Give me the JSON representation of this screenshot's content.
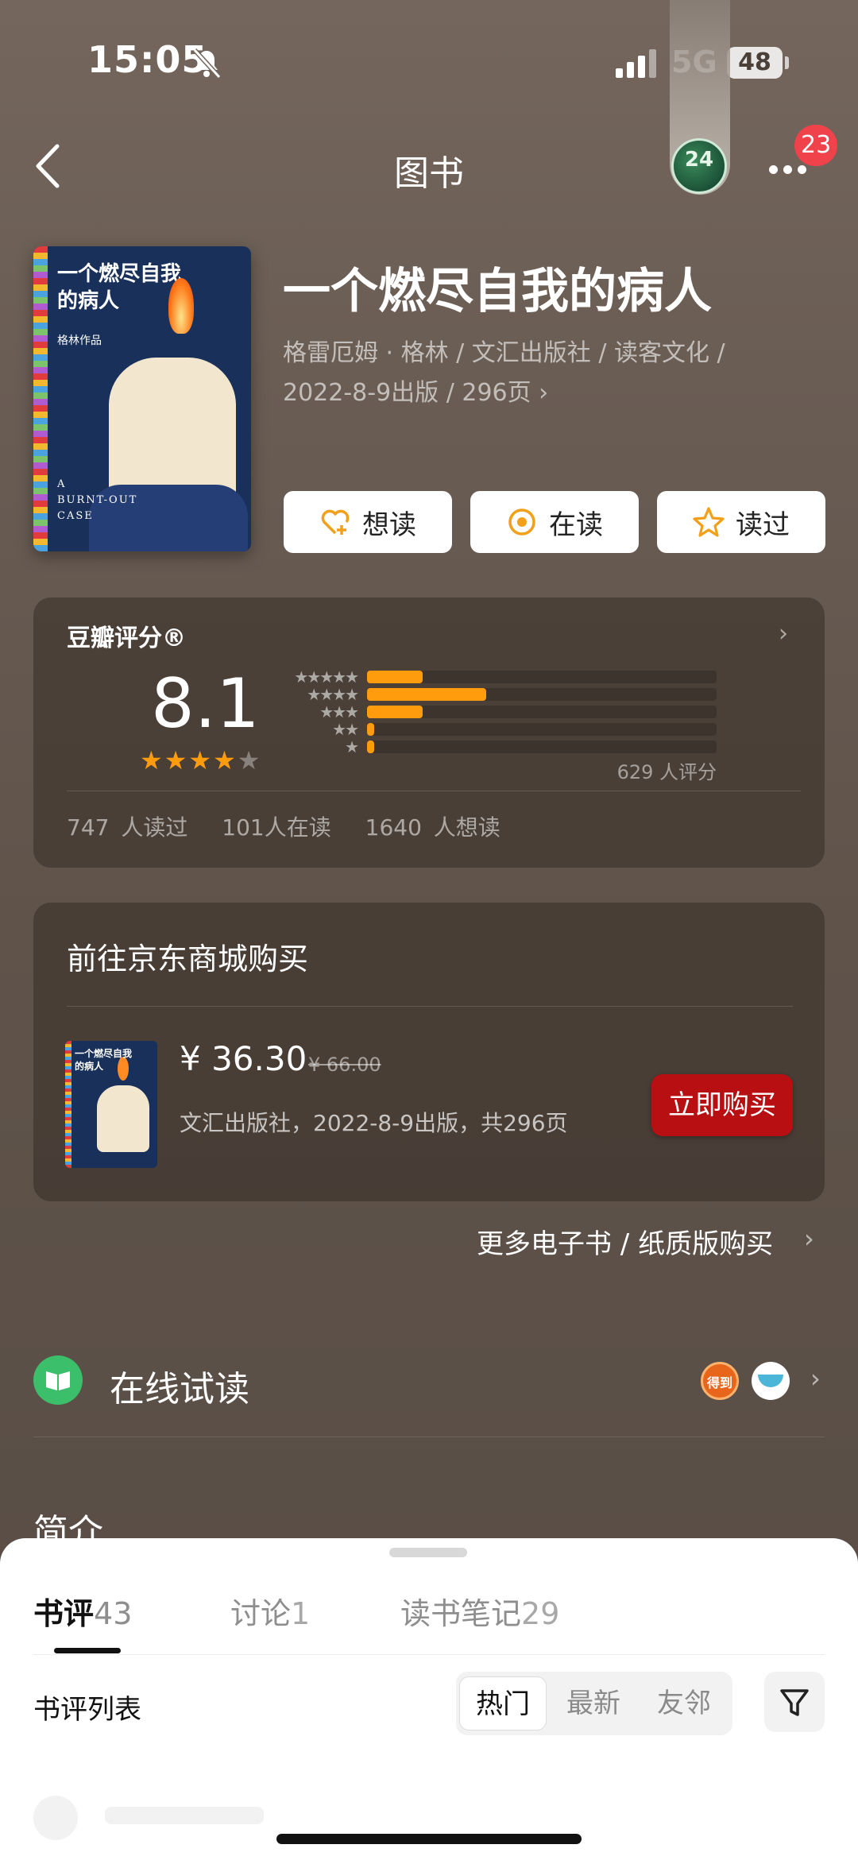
{
  "status_bar": {
    "time": "15:05",
    "network": "5G",
    "battery": "48"
  },
  "nav": {
    "title": "图书",
    "notification_count": "23",
    "avatar_text": "24"
  },
  "book": {
    "title": "一个燃尽自我的病人",
    "meta_line1": "格雷厄姆 · 格林 / 文汇出版社 / 读客文化 /",
    "meta_line2": "2022-8-9出版 / 296页",
    "cover": {
      "title_line1": "一个燃尽自我",
      "title_line2": "的病人",
      "author": "格林作品",
      "en_line1": "A",
      "en_line2": "BURNT-OUT",
      "en_line3": "CASE"
    }
  },
  "actions": [
    {
      "label": "想读",
      "icon": "heart-plus-icon"
    },
    {
      "label": "在读",
      "icon": "target-icon"
    },
    {
      "label": "读过",
      "icon": "star-outline-icon"
    }
  ],
  "rating": {
    "label": "豆瓣评分®",
    "score": "8.1",
    "stars": 4,
    "distribution_percent": [
      16,
      34,
      16,
      2,
      2
    ],
    "count_text": "629 人评分",
    "stats": [
      "747 人读过",
      "101人在读",
      "1640 人想读"
    ]
  },
  "buy": {
    "title": "前往京东商城购买",
    "price": "¥ 36.30",
    "old_price": "¥ 66.00",
    "meta": "文汇出版社，2022-8-9出版，共296页",
    "button": "立即购买"
  },
  "more_link": "更多电子书 / 纸质版购买",
  "online_read": {
    "label": "在线试读",
    "partner1_text": "得到"
  },
  "intro_heading": "简介",
  "sheet": {
    "tabs": [
      {
        "label": "书评",
        "count": "43"
      },
      {
        "label": "讨论",
        "count": "1"
      },
      {
        "label": "读书笔记",
        "count": "29"
      }
    ],
    "list_label": "书评列表",
    "segments": [
      "热门",
      "最新",
      "友邻"
    ]
  },
  "colors": {
    "accent_orange": "#ff9c0e",
    "buy_red": "#b80f12",
    "green": "#3bbf6a"
  }
}
